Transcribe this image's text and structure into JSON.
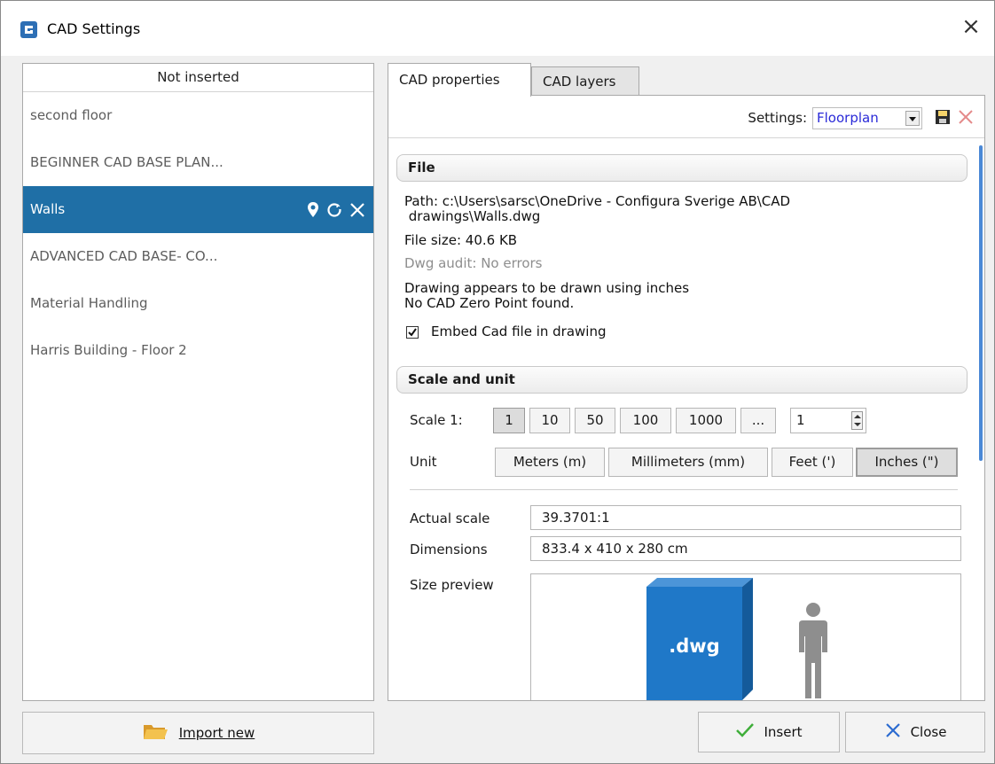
{
  "window": {
    "title": "CAD Settings"
  },
  "left_panel": {
    "header": "Not inserted",
    "items": [
      {
        "label": "second floor"
      },
      {
        "label": "BEGINNER CAD BASE PLAN..."
      },
      {
        "label": "Walls"
      },
      {
        "label": "ADVANCED CAD BASE- CO..."
      },
      {
        "label": "Material Handling"
      },
      {
        "label": "Harris Building - Floor 2"
      }
    ],
    "import_label": "Import new"
  },
  "tabs": [
    {
      "label": "CAD properties"
    },
    {
      "label": "CAD layers"
    }
  ],
  "settings": {
    "label": "Settings:",
    "value": "Floorplan"
  },
  "file": {
    "header": "File",
    "path_line1": "Path: c:\\Users\\sarsc\\OneDrive - Configura Sverige AB\\CAD",
    "path_line2": " drawings\\Walls.dwg",
    "size": "File size: 40.6 KB",
    "audit": "Dwg audit: No errors",
    "units_note": "Drawing appears to be drawn using inches",
    "zero_point": "No CAD Zero Point found.",
    "embed_label": "Embed Cad file in drawing",
    "embed_checked": true
  },
  "scale_unit": {
    "header": "Scale and unit",
    "scale_label": "Scale 1:",
    "scale_options": [
      "1",
      "10",
      "50",
      "100",
      "1000",
      "..."
    ],
    "scale_value": "1",
    "unit_label": "Unit",
    "unit_options": [
      "Meters (m)",
      "Millimeters (mm)",
      "Feet (')",
      "Inches (\")"
    ],
    "selected_unit": "Inches (\")"
  },
  "properties": {
    "actual_scale_label": "Actual scale",
    "actual_scale_value": "39.3701:1",
    "dimensions_label": "Dimensions",
    "dimensions_value": "833.4 x 410 x 280 cm",
    "size_preview_label": "Size preview",
    "preview_cube_text": ".dwg"
  },
  "buttons": {
    "insert": "Insert",
    "close": "Close"
  },
  "colors": {
    "selected": "#1f6fa6",
    "cube": "#1f78c8",
    "accent": "#2d6fb5"
  }
}
